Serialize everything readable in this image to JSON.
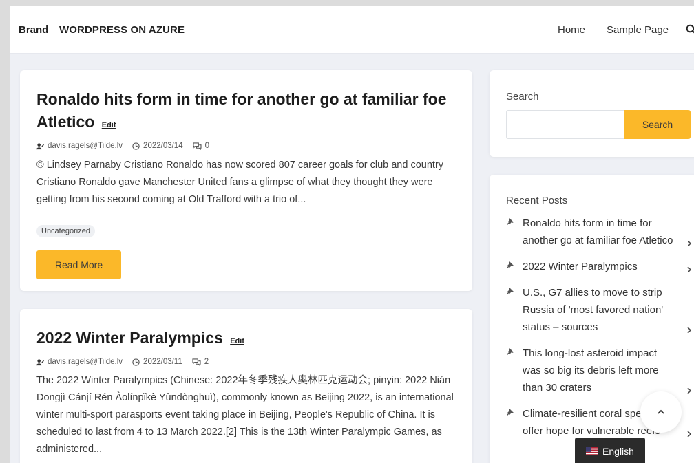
{
  "navbar": {
    "brand": "Brand",
    "site_title": "WORDPRESS ON AZURE",
    "links": [
      "Home",
      "Sample Page"
    ],
    "search_icon": "search-icon"
  },
  "posts": [
    {
      "title": "Ronaldo hits form in time for another go at familiar foe Atletico",
      "edit": "Edit",
      "author": "davis.ragels@Tilde.lv",
      "date": "2022/03/14",
      "comments": "0",
      "excerpt": "© Lindsey Parnaby Cristiano Ronaldo has now scored 807 career goals for club and country Cristiano Ronaldo gave Manchester United fans a glimpse of what they thought they were getting from his second coming at Old Trafford with a trio of...",
      "category": "Uncategorized",
      "read_more": "Read More"
    },
    {
      "title": "2022 Winter Paralympics",
      "edit": "Edit",
      "author": "davis.ragels@Tilde.lv",
      "date": "2022/03/11",
      "comments": "2",
      "excerpt": "The 2022 Winter Paralympics (Chinese: 2022年冬季残疾人奥林匹克运动会; pinyin: 2022 Nián Dōngjì Cánjí Rén Àolínpǐkè Yùndònghuì), commonly known as Beijing 2022, is an international winter multi-sport parasports event taking place in Beijing, People's Republic of China. It is scheduled to last from 4 to 13 March 2022.[2] This is the 13th Winter Paralympic Games, as administered..."
    }
  ],
  "sidebar": {
    "search_label": "Search",
    "search_value": "",
    "search_button": "Search",
    "recent_label": "Recent Posts",
    "recent_posts": [
      "Ronaldo hits form in time for another go at familiar foe Atletico",
      "2022 Winter Paralympics",
      "U.S., G7 allies to move to strip Russia of 'most favored nation' status – sources",
      "This long-lost asteroid impact was so big its debris left more than 30 craters",
      "Climate-resilient coral species offer hope for vulnerable reefs"
    ]
  },
  "language": {
    "label": "English",
    "flag": "us-flag-icon"
  },
  "colors": {
    "accent": "#fbb829",
    "background": "#eef0f5",
    "card": "#ffffff"
  }
}
